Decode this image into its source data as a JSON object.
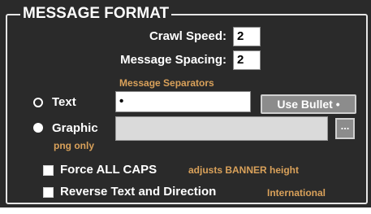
{
  "section": {
    "title": "MESSAGE FORMAT"
  },
  "crawl_speed": {
    "label": "Crawl Speed:",
    "value": "2"
  },
  "message_spacing": {
    "label": "Message Spacing:",
    "value": "2"
  },
  "separators": {
    "heading": "Message Separators",
    "text_option": {
      "label": "Text",
      "value": "•",
      "selected": false
    },
    "use_bullet_label": "Use Bullet •",
    "graphic_option": {
      "label": "Graphic",
      "note": "png only",
      "selected": true,
      "browse_label": "..."
    }
  },
  "options": {
    "force_caps": {
      "label": "Force ALL CAPS",
      "note": "adjusts BANNER height",
      "checked": false
    },
    "reverse": {
      "label": "Reverse Text and Direction",
      "note": "International",
      "checked": false
    }
  },
  "colors": {
    "panel_background": "#2a2a2a",
    "note_text": "#d9a15a",
    "button_background": "#8c8c8c"
  }
}
